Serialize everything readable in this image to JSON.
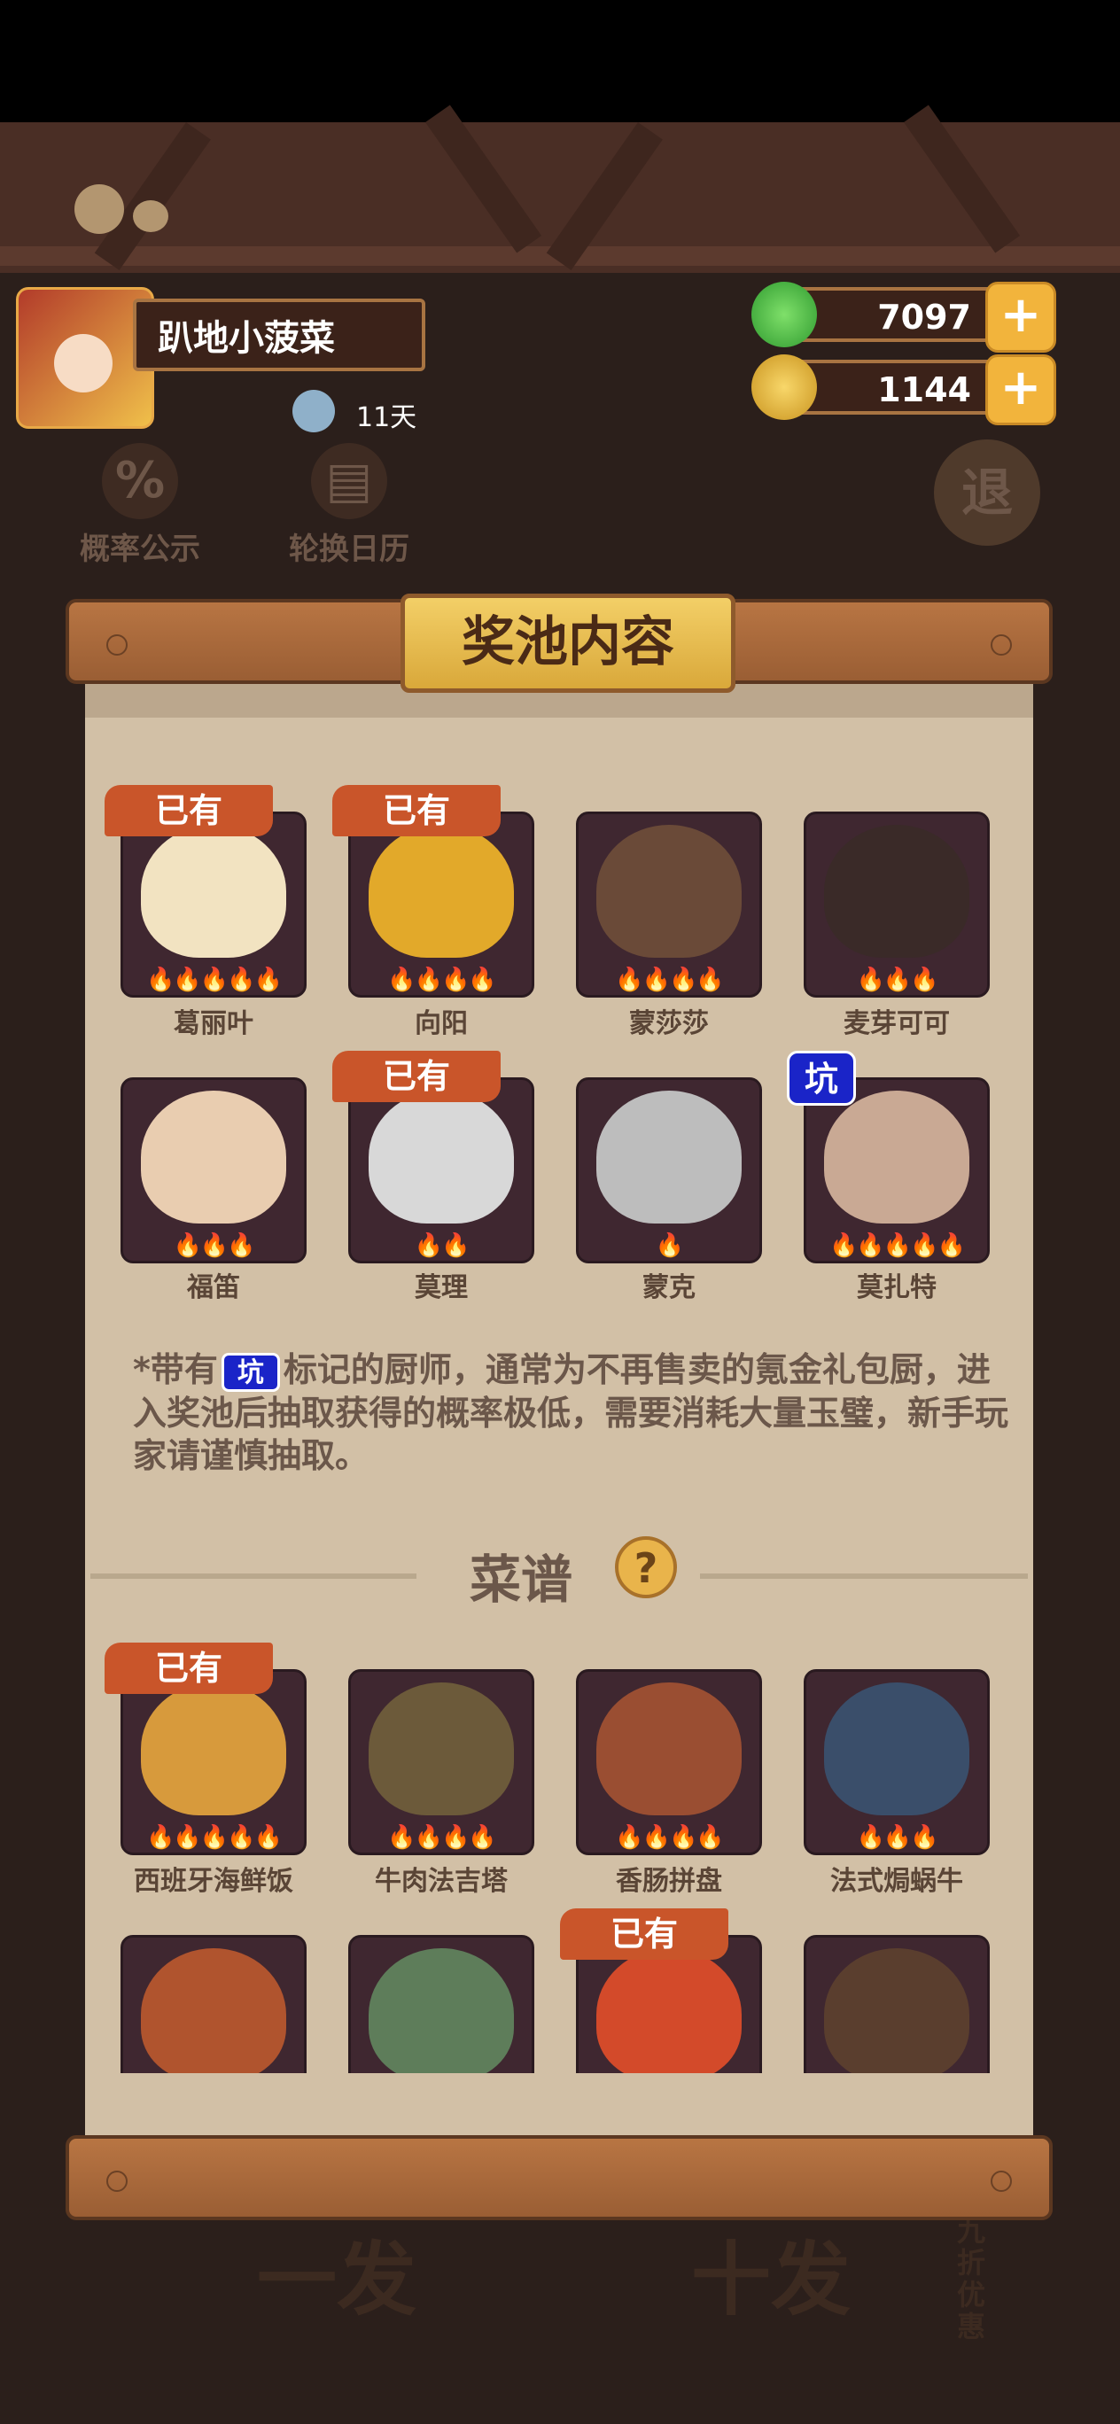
{
  "player": {
    "name": "趴地小菠菜",
    "days": "11天"
  },
  "currencies": {
    "jade": "7097",
    "coin": "1144"
  },
  "shortcuts": {
    "probability": "概率公示",
    "calendar": "轮换日历",
    "exit_label": "退"
  },
  "modal": {
    "title": "奖池内容",
    "owned_label": "已有",
    "keng_label": "坑",
    "chefs": [
      {
        "name": "葛丽叶",
        "flames": "🔥🔥🔥🔥🔥",
        "owned": true
      },
      {
        "name": "向阳",
        "flames": "🔥🔥🔥🔥",
        "owned": true
      },
      {
        "name": "蒙莎莎",
        "flames": "🔥🔥🔥🔥",
        "owned": false
      },
      {
        "name": "麦芽可可",
        "flames": "🔥🔥🔥",
        "owned": false
      },
      {
        "name": "福笛",
        "flames": "🔥🔥🔥",
        "owned": false
      },
      {
        "name": "莫理",
        "flames": "🔥🔥",
        "owned": true
      },
      {
        "name": "蒙克",
        "flames": "🔥",
        "owned": false
      },
      {
        "name": "莫扎特",
        "flames": "🔥🔥🔥🔥🔥",
        "owned": false,
        "keng": true
      }
    ],
    "note_prefix": "*带有",
    "note_suffix": "标记的厨师，通常为不再售卖的氪金礼包厨，进入奖池后抽取获得的概率极低，需要消耗大量玉璧，新手玩家请谨慎抽取。",
    "recipe_section_title": "菜谱",
    "recipes": [
      {
        "name": "西班牙海鲜饭",
        "flames": "🔥🔥🔥🔥🔥",
        "owned": true
      },
      {
        "name": "牛肉法吉塔",
        "flames": "🔥🔥🔥🔥",
        "owned": false
      },
      {
        "name": "香肠拼盘",
        "flames": "🔥🔥🔥🔥",
        "owned": false
      },
      {
        "name": "法式焗蜗牛",
        "flames": "🔥🔥🔥",
        "owned": false
      }
    ],
    "recipes_row2_owned_index": 2
  },
  "background_buttons": {
    "draw_one": "一发",
    "draw_ten": "十发",
    "discount": "九折优惠"
  }
}
